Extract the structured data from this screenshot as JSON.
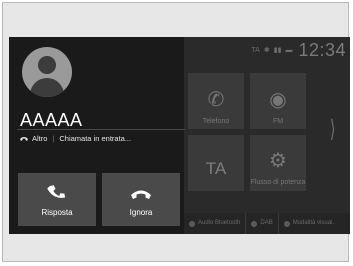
{
  "home": {
    "status_text": "TA",
    "clock": "12:34",
    "tiles": [
      {
        "label": "Telefono"
      },
      {
        "label": "FM"
      },
      {
        "label": "TA"
      },
      {
        "label": "Flusso di potenza"
      }
    ],
    "bottom_bar": [
      {
        "label": "Audio Bluetooth"
      },
      {
        "label": "DAB"
      },
      {
        "label": "Modalità visual."
      }
    ]
  },
  "call": {
    "caller_name": "AAAAA",
    "caller_type": "Altro",
    "status": "Chiamata in entrata...",
    "answer_label": "Risposta",
    "ignore_label": "Ignora"
  }
}
